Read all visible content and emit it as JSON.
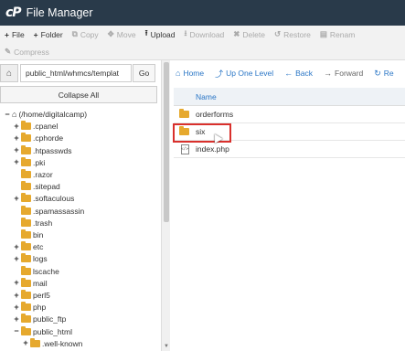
{
  "app": {
    "logo": "cP",
    "title": "File Manager"
  },
  "toolbar": {
    "row1": [
      {
        "icon": "plus-icon",
        "glyph": "+",
        "label": "File",
        "enabled": true
      },
      {
        "icon": "plus-icon",
        "glyph": "+",
        "label": "Folder",
        "enabled": true
      },
      {
        "icon": "copy-icon",
        "glyph": "⧉",
        "label": "Copy",
        "enabled": false
      },
      {
        "icon": "move-icon",
        "glyph": "✥",
        "label": "Move",
        "enabled": false
      },
      {
        "icon": "upload-icon",
        "glyph": "⭱",
        "label": "Upload",
        "enabled": true
      },
      {
        "icon": "download-icon",
        "glyph": "⭳",
        "label": "Download",
        "enabled": false
      },
      {
        "icon": "delete-icon",
        "glyph": "✖",
        "label": "Delete",
        "enabled": false
      },
      {
        "icon": "restore-icon",
        "glyph": "↺",
        "label": "Restore",
        "enabled": false
      },
      {
        "icon": "rename-icon",
        "glyph": "▤",
        "label": "Renam",
        "enabled": false
      }
    ],
    "row2": [
      {
        "icon": "compress-icon",
        "glyph": "✎",
        "label": "Compress",
        "enabled": false
      }
    ]
  },
  "left": {
    "path_value": "public_html/whmcs/templat",
    "go_label": "Go",
    "collapse_label": "Collapse All",
    "tree": [
      {
        "label": "(/home/digitalcamp)",
        "indent": 0,
        "toggle": "−",
        "type": "home"
      },
      {
        "label": ".cpanel",
        "indent": 1,
        "toggle": "+",
        "type": "folder"
      },
      {
        "label": ".cphorde",
        "indent": 1,
        "toggle": "+",
        "type": "folder"
      },
      {
        "label": ".htpasswds",
        "indent": 1,
        "toggle": "+",
        "type": "folder"
      },
      {
        "label": ".pki",
        "indent": 1,
        "toggle": "+",
        "type": "folder"
      },
      {
        "label": ".razor",
        "indent": 1,
        "toggle": "",
        "type": "folder"
      },
      {
        "label": ".sitepad",
        "indent": 1,
        "toggle": "",
        "type": "folder"
      },
      {
        "label": ".softaculous",
        "indent": 1,
        "toggle": "+",
        "type": "folder"
      },
      {
        "label": ".spamassassin",
        "indent": 1,
        "toggle": "",
        "type": "folder"
      },
      {
        "label": ".trash",
        "indent": 1,
        "toggle": "",
        "type": "folder"
      },
      {
        "label": "bin",
        "indent": 1,
        "toggle": "",
        "type": "folder"
      },
      {
        "label": "etc",
        "indent": 1,
        "toggle": "+",
        "type": "folder"
      },
      {
        "label": "logs",
        "indent": 1,
        "toggle": "+",
        "type": "folder"
      },
      {
        "label": "lscache",
        "indent": 1,
        "toggle": "",
        "type": "folder"
      },
      {
        "label": "mail",
        "indent": 1,
        "toggle": "+",
        "type": "folder"
      },
      {
        "label": "perl5",
        "indent": 1,
        "toggle": "+",
        "type": "folder"
      },
      {
        "label": "php",
        "indent": 1,
        "toggle": "+",
        "type": "folder"
      },
      {
        "label": "public_ftp",
        "indent": 1,
        "toggle": "+",
        "type": "folder"
      },
      {
        "label": "public_html",
        "indent": 1,
        "toggle": "−",
        "type": "folder"
      },
      {
        "label": ".well-known",
        "indent": 2,
        "toggle": "+",
        "type": "folder"
      }
    ]
  },
  "right": {
    "nav": [
      {
        "icon": "home-icon",
        "glyph": "⌂",
        "label": "Home",
        "enabled": true
      },
      {
        "icon": "level-up-icon",
        "glyph": "⤴",
        "label": "Up One Level",
        "enabled": true
      },
      {
        "icon": "back-icon",
        "glyph": "←",
        "label": "Back",
        "enabled": true
      },
      {
        "icon": "forward-icon",
        "glyph": "→",
        "label": "Forward",
        "enabled": false
      },
      {
        "icon": "reload-icon",
        "glyph": "↻",
        "label": "Re",
        "enabled": true
      }
    ],
    "column_name": "Name",
    "files": [
      {
        "name": "orderforms",
        "type": "folder"
      },
      {
        "name": "six",
        "type": "folder"
      },
      {
        "name": "index.php",
        "type": "file",
        "file_badge": "&lt;/&gt;"
      }
    ]
  },
  "colors": {
    "titlebar": "#293a4a",
    "link": "#2a76c6",
    "folder": "#e6a92e",
    "highlight": "#d9302c"
  }
}
